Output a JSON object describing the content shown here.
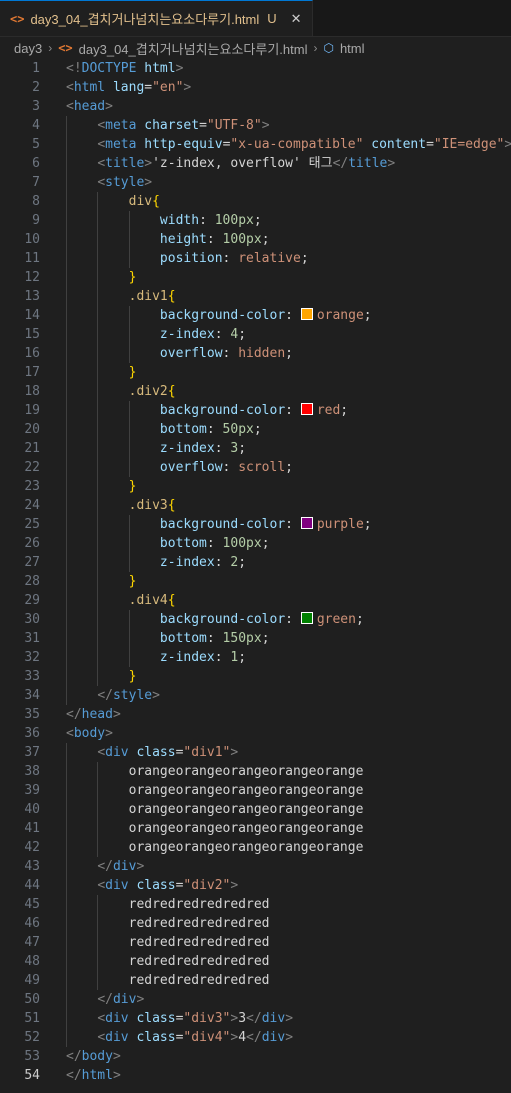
{
  "tab": {
    "icon": "<>",
    "filename": "day3_04_겹치거나넘치는요소다루기.html",
    "status": "U",
    "close": "✕"
  },
  "breadcrumb": {
    "folder": "day3",
    "file": "day3_04_겹치거나넘치는요소다루기.html",
    "symbol": "html"
  },
  "colors": {
    "orange": "#ffa500",
    "red": "#ff0000",
    "purple": "#800080",
    "green": "#008000"
  },
  "lines": [
    [
      [
        "t-tag",
        "<!"
      ],
      [
        "t-doc",
        "DOCTYPE"
      ],
      [
        "t-text",
        " "
      ],
      [
        "t-attr",
        "html"
      ],
      [
        "t-tag",
        ">"
      ]
    ],
    [
      [
        "t-tag",
        "<"
      ],
      [
        "t-name",
        "html"
      ],
      [
        "t-text",
        " "
      ],
      [
        "t-attr",
        "lang"
      ],
      [
        "t-text",
        "="
      ],
      [
        "t-str",
        "\"en\""
      ],
      [
        "t-tag",
        ">"
      ]
    ],
    [
      [
        "t-tag",
        "<"
      ],
      [
        "t-name",
        "head"
      ],
      [
        "t-tag",
        ">"
      ]
    ],
    [
      [
        "t-text",
        "    "
      ],
      [
        "t-tag",
        "<"
      ],
      [
        "t-name",
        "meta"
      ],
      [
        "t-text",
        " "
      ],
      [
        "t-attr",
        "charset"
      ],
      [
        "t-text",
        "="
      ],
      [
        "t-str",
        "\"UTF-8\""
      ],
      [
        "t-tag",
        ">"
      ]
    ],
    [
      [
        "t-text",
        "    "
      ],
      [
        "t-tag",
        "<"
      ],
      [
        "t-name",
        "meta"
      ],
      [
        "t-text",
        " "
      ],
      [
        "t-attr",
        "http-equiv"
      ],
      [
        "t-text",
        "="
      ],
      [
        "t-str",
        "\"x-ua-compatible\""
      ],
      [
        "t-text",
        " "
      ],
      [
        "t-attr",
        "content"
      ],
      [
        "t-text",
        "="
      ],
      [
        "t-str",
        "\"IE=edge\""
      ],
      [
        "t-tag",
        ">"
      ]
    ],
    [
      [
        "t-text",
        "    "
      ],
      [
        "t-tag",
        "<"
      ],
      [
        "t-name",
        "title"
      ],
      [
        "t-tag",
        ">"
      ],
      [
        "t-text",
        "'z-index, overflow' 태그"
      ],
      [
        "t-tag",
        "</"
      ],
      [
        "t-name",
        "title"
      ],
      [
        "t-tag",
        ">"
      ]
    ],
    [
      [
        "t-text",
        "    "
      ],
      [
        "t-tag",
        "<"
      ],
      [
        "t-name",
        "style"
      ],
      [
        "t-tag",
        ">"
      ]
    ],
    [
      [
        "t-text",
        "        "
      ],
      [
        "t-sel",
        "div"
      ],
      [
        "t-brace",
        "{"
      ]
    ],
    [
      [
        "t-text",
        "            "
      ],
      [
        "t-prop",
        "width"
      ],
      [
        "t-text",
        ": "
      ],
      [
        "t-num",
        "100px"
      ],
      [
        "t-text",
        ";"
      ]
    ],
    [
      [
        "t-text",
        "            "
      ],
      [
        "t-prop",
        "height"
      ],
      [
        "t-text",
        ": "
      ],
      [
        "t-num",
        "100px"
      ],
      [
        "t-text",
        ";"
      ]
    ],
    [
      [
        "t-text",
        "            "
      ],
      [
        "t-prop",
        "position"
      ],
      [
        "t-text",
        ": "
      ],
      [
        "t-val",
        "relative"
      ],
      [
        "t-text",
        ";"
      ]
    ],
    [
      [
        "t-text",
        "        "
      ],
      [
        "t-brace",
        "}"
      ]
    ],
    [
      [
        "t-text",
        "        "
      ],
      [
        "t-sel",
        ".div1"
      ],
      [
        "t-brace",
        "{"
      ]
    ],
    [
      [
        "t-text",
        "            "
      ],
      [
        "t-prop",
        "background-color"
      ],
      [
        "t-text",
        ": "
      ],
      [
        "swatch",
        "orange"
      ],
      [
        "t-val",
        "orange"
      ],
      [
        "t-text",
        ";"
      ]
    ],
    [
      [
        "t-text",
        "            "
      ],
      [
        "t-prop",
        "z-index"
      ],
      [
        "t-text",
        ": "
      ],
      [
        "t-num",
        "4"
      ],
      [
        "t-text",
        ";"
      ]
    ],
    [
      [
        "t-text",
        "            "
      ],
      [
        "t-prop",
        "overflow"
      ],
      [
        "t-text",
        ": "
      ],
      [
        "t-val",
        "hidden"
      ],
      [
        "t-text",
        ";"
      ]
    ],
    [
      [
        "t-text",
        "        "
      ],
      [
        "t-brace",
        "}"
      ]
    ],
    [
      [
        "t-text",
        "        "
      ],
      [
        "t-sel",
        ".div2"
      ],
      [
        "t-brace",
        "{"
      ]
    ],
    [
      [
        "t-text",
        "            "
      ],
      [
        "t-prop",
        "background-color"
      ],
      [
        "t-text",
        ": "
      ],
      [
        "swatch",
        "red"
      ],
      [
        "t-val",
        "red"
      ],
      [
        "t-text",
        ";"
      ]
    ],
    [
      [
        "t-text",
        "            "
      ],
      [
        "t-prop",
        "bottom"
      ],
      [
        "t-text",
        ": "
      ],
      [
        "t-num",
        "50px"
      ],
      [
        "t-text",
        ";"
      ]
    ],
    [
      [
        "t-text",
        "            "
      ],
      [
        "t-prop",
        "z-index"
      ],
      [
        "t-text",
        ": "
      ],
      [
        "t-num",
        "3"
      ],
      [
        "t-text",
        ";"
      ]
    ],
    [
      [
        "t-text",
        "            "
      ],
      [
        "t-prop",
        "overflow"
      ],
      [
        "t-text",
        ": "
      ],
      [
        "t-val",
        "scroll"
      ],
      [
        "t-text",
        ";"
      ]
    ],
    [
      [
        "t-text",
        "        "
      ],
      [
        "t-brace",
        "}"
      ]
    ],
    [
      [
        "t-text",
        "        "
      ],
      [
        "t-sel",
        ".div3"
      ],
      [
        "t-brace",
        "{"
      ]
    ],
    [
      [
        "t-text",
        "            "
      ],
      [
        "t-prop",
        "background-color"
      ],
      [
        "t-text",
        ": "
      ],
      [
        "swatch",
        "purple"
      ],
      [
        "t-val",
        "purple"
      ],
      [
        "t-text",
        ";"
      ]
    ],
    [
      [
        "t-text",
        "            "
      ],
      [
        "t-prop",
        "bottom"
      ],
      [
        "t-text",
        ": "
      ],
      [
        "t-num",
        "100px"
      ],
      [
        "t-text",
        ";"
      ]
    ],
    [
      [
        "t-text",
        "            "
      ],
      [
        "t-prop",
        "z-index"
      ],
      [
        "t-text",
        ": "
      ],
      [
        "t-num",
        "2"
      ],
      [
        "t-text",
        ";"
      ]
    ],
    [
      [
        "t-text",
        "        "
      ],
      [
        "t-brace",
        "}"
      ]
    ],
    [
      [
        "t-text",
        "        "
      ],
      [
        "t-sel",
        ".div4"
      ],
      [
        "t-brace",
        "{"
      ]
    ],
    [
      [
        "t-text",
        "            "
      ],
      [
        "t-prop",
        "background-color"
      ],
      [
        "t-text",
        ": "
      ],
      [
        "swatch",
        "green"
      ],
      [
        "t-val",
        "green"
      ],
      [
        "t-text",
        ";"
      ]
    ],
    [
      [
        "t-text",
        "            "
      ],
      [
        "t-prop",
        "bottom"
      ],
      [
        "t-text",
        ": "
      ],
      [
        "t-num",
        "150px"
      ],
      [
        "t-text",
        ";"
      ]
    ],
    [
      [
        "t-text",
        "            "
      ],
      [
        "t-prop",
        "z-index"
      ],
      [
        "t-text",
        ": "
      ],
      [
        "t-num",
        "1"
      ],
      [
        "t-text",
        ";"
      ]
    ],
    [
      [
        "t-text",
        "        "
      ],
      [
        "t-brace",
        "}"
      ]
    ],
    [
      [
        "t-text",
        "    "
      ],
      [
        "t-tag",
        "</"
      ],
      [
        "t-name",
        "style"
      ],
      [
        "t-tag",
        ">"
      ]
    ],
    [
      [
        "t-tag",
        "</"
      ],
      [
        "t-name",
        "head"
      ],
      [
        "t-tag",
        ">"
      ]
    ],
    [
      [
        "t-tag",
        "<"
      ],
      [
        "t-name",
        "body"
      ],
      [
        "t-tag",
        ">"
      ]
    ],
    [
      [
        "t-text",
        "    "
      ],
      [
        "t-tag",
        "<"
      ],
      [
        "t-name",
        "div"
      ],
      [
        "t-text",
        " "
      ],
      [
        "t-attr",
        "class"
      ],
      [
        "t-text",
        "="
      ],
      [
        "t-str",
        "\"div1\""
      ],
      [
        "t-tag",
        ">"
      ]
    ],
    [
      [
        "t-text",
        "        orangeorangeorangeorangeorange"
      ]
    ],
    [
      [
        "t-text",
        "        orangeorangeorangeorangeorange"
      ]
    ],
    [
      [
        "t-text",
        "        orangeorangeorangeorangeorange"
      ]
    ],
    [
      [
        "t-text",
        "        orangeorangeorangeorangeorange"
      ]
    ],
    [
      [
        "t-text",
        "        orangeorangeorangeorangeorange"
      ]
    ],
    [
      [
        "t-text",
        "    "
      ],
      [
        "t-tag",
        "</"
      ],
      [
        "t-name",
        "div"
      ],
      [
        "t-tag",
        ">"
      ]
    ],
    [
      [
        "t-text",
        "    "
      ],
      [
        "t-tag",
        "<"
      ],
      [
        "t-name",
        "div"
      ],
      [
        "t-text",
        " "
      ],
      [
        "t-attr",
        "class"
      ],
      [
        "t-text",
        "="
      ],
      [
        "t-str",
        "\"div2\""
      ],
      [
        "t-tag",
        ">"
      ]
    ],
    [
      [
        "t-text",
        "        redredredredredred"
      ]
    ],
    [
      [
        "t-text",
        "        redredredredredred"
      ]
    ],
    [
      [
        "t-text",
        "        redredredredredred"
      ]
    ],
    [
      [
        "t-text",
        "        redredredredredred"
      ]
    ],
    [
      [
        "t-text",
        "        redredredredredred"
      ]
    ],
    [
      [
        "t-text",
        "    "
      ],
      [
        "t-tag",
        "</"
      ],
      [
        "t-name",
        "div"
      ],
      [
        "t-tag",
        ">"
      ]
    ],
    [
      [
        "t-text",
        "    "
      ],
      [
        "t-tag",
        "<"
      ],
      [
        "t-name",
        "div"
      ],
      [
        "t-text",
        " "
      ],
      [
        "t-attr",
        "class"
      ],
      [
        "t-text",
        "="
      ],
      [
        "t-str",
        "\"div3\""
      ],
      [
        "t-tag",
        ">"
      ],
      [
        "t-text",
        "3"
      ],
      [
        "t-tag",
        "</"
      ],
      [
        "t-name",
        "div"
      ],
      [
        "t-tag",
        ">"
      ]
    ],
    [
      [
        "t-text",
        "    "
      ],
      [
        "t-tag",
        "<"
      ],
      [
        "t-name",
        "div"
      ],
      [
        "t-text",
        " "
      ],
      [
        "t-attr",
        "class"
      ],
      [
        "t-text",
        "="
      ],
      [
        "t-str",
        "\"div4\""
      ],
      [
        "t-tag",
        ">"
      ],
      [
        "t-text",
        "4"
      ],
      [
        "t-tag",
        "</"
      ],
      [
        "t-name",
        "div"
      ],
      [
        "t-tag",
        ">"
      ]
    ],
    [
      [
        "t-tag",
        "</"
      ],
      [
        "t-name",
        "body"
      ],
      [
        "t-tag",
        ">"
      ]
    ],
    [
      [
        "t-tag",
        "</"
      ],
      [
        "t-name",
        "html"
      ],
      [
        "t-tag",
        ">"
      ]
    ]
  ],
  "active_line": 54
}
